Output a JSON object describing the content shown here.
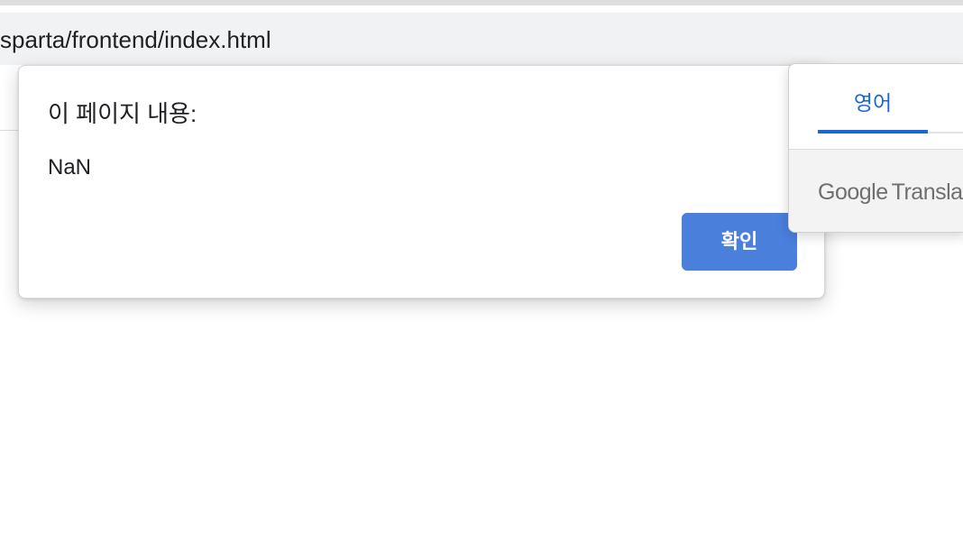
{
  "browser": {
    "address_text": "sparta/frontend/index.html"
  },
  "alert_dialog": {
    "title": "이 페이지 내용:",
    "message": "NaN",
    "ok_label": "확인",
    "ok_color": "#4a7fdc"
  },
  "translate_popup": {
    "active_tab": "영어",
    "accent_color": "#1a67d2",
    "brand_word_1": "Google",
    "brand_word_2": "Translat"
  }
}
